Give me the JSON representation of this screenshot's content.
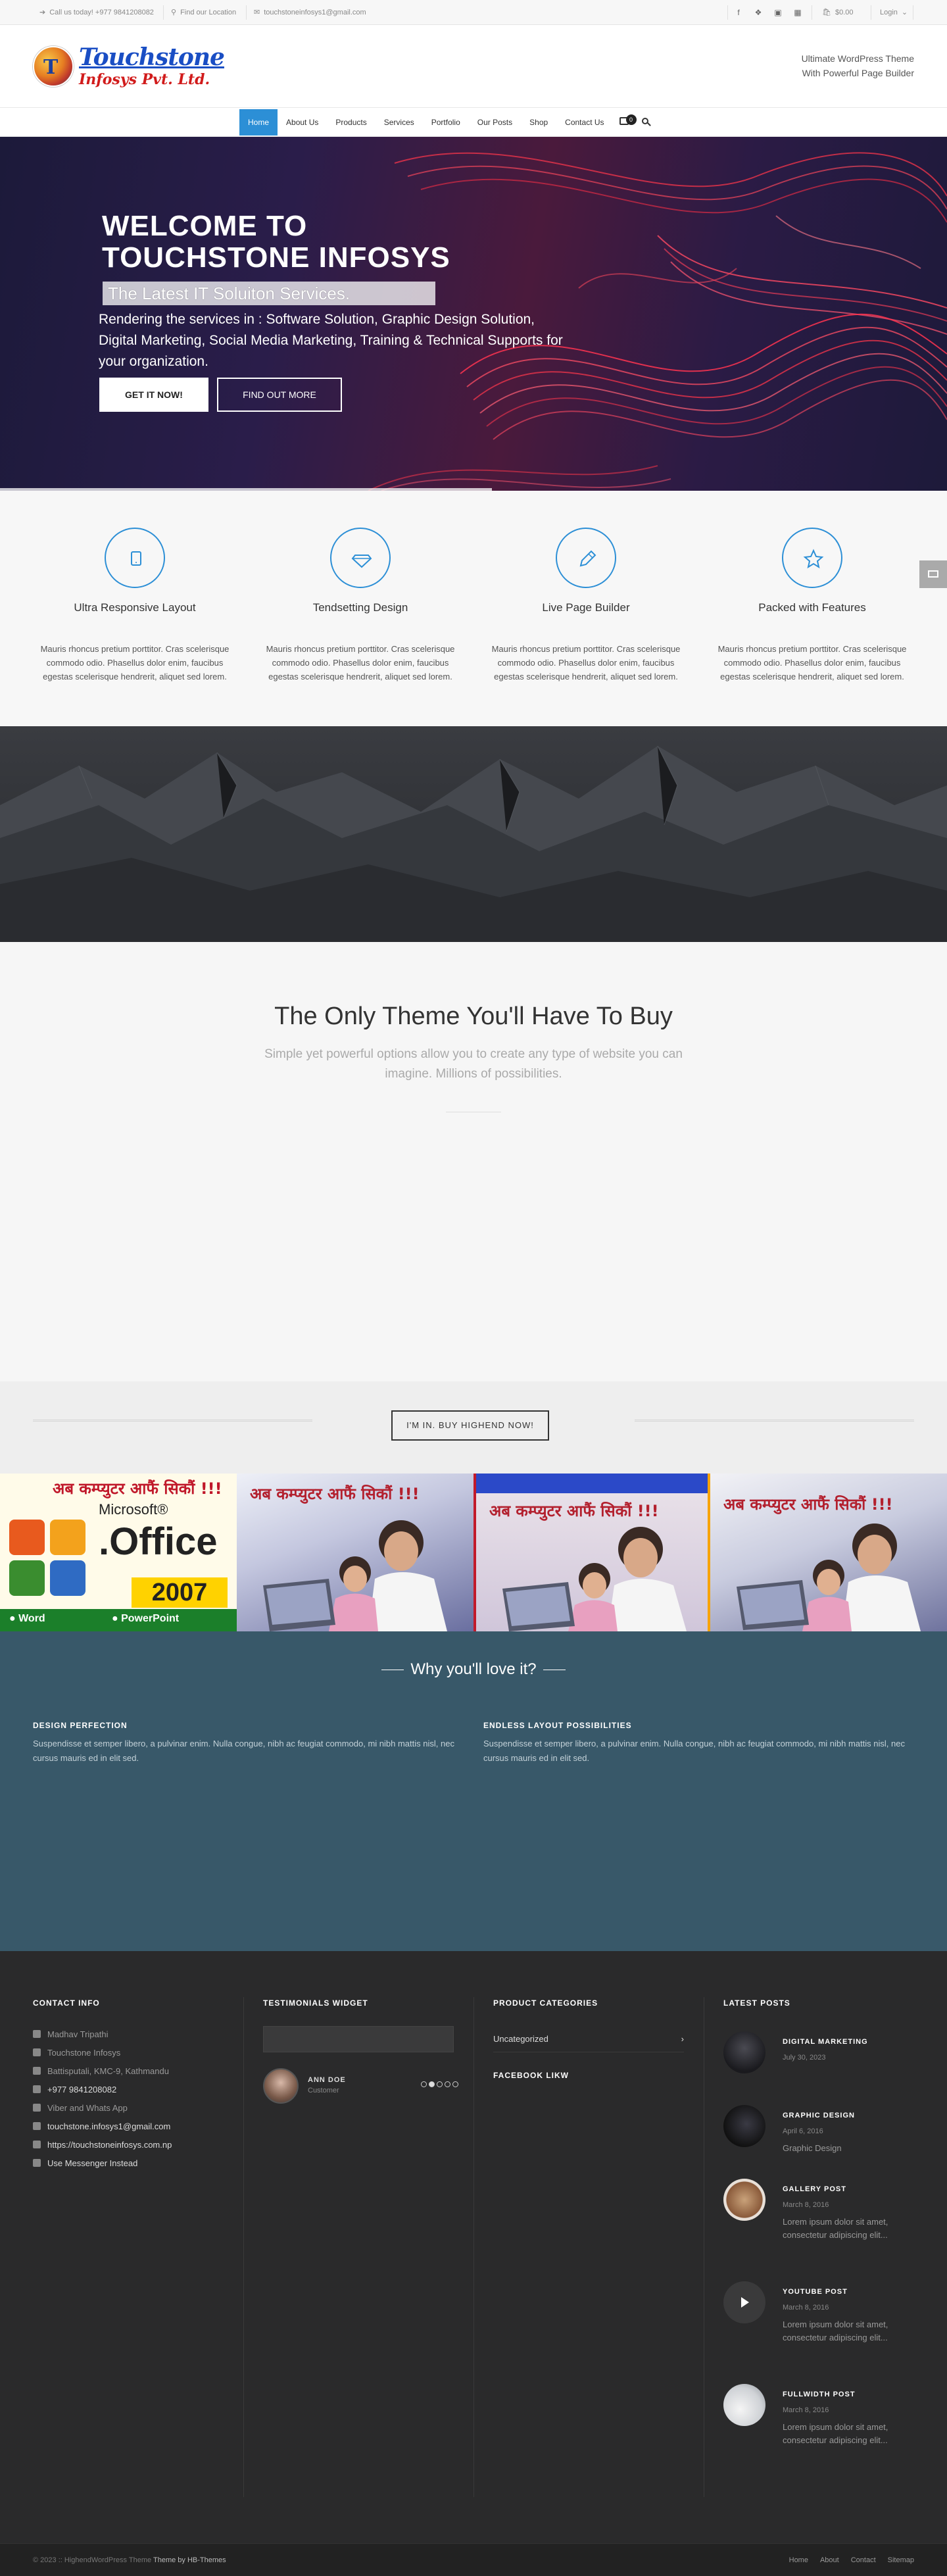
{
  "topbar": {
    "phone": "Call us today! +977 9841208082",
    "location": "Find our Location",
    "email": "touchstoneinfosys1@gmail.com",
    "cart_amount": "$0.00",
    "login": "Login"
  },
  "header": {
    "logo_line1": "Touchstone",
    "logo_line2": "Infosys Pvt. Ltd.",
    "logo_letter": "T",
    "tagline_line1": "Ultimate WordPress Theme",
    "tagline_line2": "With Powerful Page Builder"
  },
  "nav": {
    "items": [
      "Home",
      "About Us",
      "Products",
      "Services",
      "Portfolio",
      "Our Posts",
      "Shop",
      "Contact Us"
    ],
    "cart_count": "0"
  },
  "hero": {
    "title_line1": "WELCOME TO",
    "title_line2": "TOUCHSTONE INFOSYS",
    "subtitle": "The Latest IT Soluiton Services.",
    "description": "Rendering the services in : Software Solution, Graphic Design Solution, Digital Marketing, Social Media Marketing, Training & Technical Supports for your organization.",
    "button_primary": "GET IT NOW!",
    "button_secondary": "FIND OUT MORE"
  },
  "features": [
    {
      "title": "Ultra Responsive Layout",
      "icon": "tablet-icon",
      "desc": "Mauris rhoncus pretium porttitor. Cras scelerisque commodo odio. Phasellus dolor enim, faucibus egestas scelerisque hendrerit, aliquet sed lorem."
    },
    {
      "title": "Tendsetting Design",
      "icon": "diamond-icon",
      "desc": "Mauris rhoncus pretium porttitor. Cras scelerisque commodo odio. Phasellus dolor enim, faucibus egestas scelerisque hendrerit, aliquet sed lorem."
    },
    {
      "title": "Live Page Builder",
      "icon": "pencil-icon",
      "desc": "Mauris rhoncus pretium porttitor. Cras scelerisque commodo odio. Phasellus dolor enim, faucibus egestas scelerisque hendrerit, aliquet sed lorem."
    },
    {
      "title": "Packed with Features",
      "icon": "star-icon",
      "desc": "Mauris rhoncus pretium porttitor. Cras scelerisque commodo odio. Phasellus dolor enim, faucibus egestas scelerisque hendrerit, aliquet sed lorem."
    }
  ],
  "only_theme": {
    "title": "The Only Theme You'll Have To Buy",
    "subtitle": "Simple yet powerful options allow you to create any type of website you can imagine. Millions of possibilities."
  },
  "cta": {
    "button": "I'M IN. BUY HIGHEND NOW!"
  },
  "gallery": {
    "office_ms": "Microsoft®",
    "office_word": ".Office",
    "office_year": "2007",
    "office_bar_left": "● Word",
    "office_bar_right": "● PowerPoint",
    "banner_text": "अब कम्प्युटर आफैं सिकौं !!!"
  },
  "why": {
    "title": "Why you'll love it?",
    "col1_title": "DESIGN PERFECTION",
    "col1_text": "Suspendisse et semper libero, a pulvinar enim. Nulla congue, nibh ac feugiat commodo, mi nibh mattis nisl, nec cursus mauris ed in elit sed.",
    "col2_title": "ENDLESS LAYOUT POSSIBILITIES",
    "col2_text": "Suspendisse et semper libero, a pulvinar enim. Nulla congue, nibh ac feugiat commodo, mi nibh mattis nisl, nec cursus mauris ed in elit sed."
  },
  "footer": {
    "contact_title": "CONTACT INFO",
    "contact_rows": [
      "Madhav Tripathi",
      "Touchstone Infosys",
      "Battisputali, KMC-9, Kathmandu",
      "+977 9841208082",
      "Viber and Whats App",
      "touchstone.infosys1@gmail.com",
      "https://touchstoneinfosys.com.np",
      "Use Messenger Instead"
    ],
    "testimonials_title": "TESTIMONIALS WIDGET",
    "testimonial_name": "ANN DOE",
    "testimonial_role": "Customer",
    "categories_title": "PRODUCT CATEGORIES",
    "category": "Uncategorized",
    "facebook_title": "FACEBOOK LIKW",
    "latest_title": "LATEST POSTS",
    "posts": [
      {
        "title": "DIGITAL MARKETING",
        "date": "July 30, 2023",
        "excerpt": ""
      },
      {
        "title": "GRAPHIC DESIGN",
        "date": "April 6, 2016",
        "excerpt": "Graphic Design"
      },
      {
        "title": "GALLERY POST",
        "date": "March 8, 2016",
        "excerpt": "Lorem ipsum dolor sit amet, consectetur adipiscing elit..."
      },
      {
        "title": "YOUTUBE POST",
        "date": "March 8, 2016",
        "excerpt": "Lorem ipsum dolor sit amet, consectetur adipiscing elit..."
      },
      {
        "title": "FULLWIDTH POST",
        "date": "March 8, 2016",
        "excerpt": "Lorem ipsum dolor sit amet, consectetur adipiscing elit..."
      }
    ]
  },
  "copyright": {
    "text": "© 2023 :: HighendWordPress Theme",
    "by": "Theme by HB-Themes",
    "links": [
      "Home",
      "About",
      "Contact",
      "Sitemap"
    ]
  },
  "colors": {
    "accent": "#2c8fd6",
    "why_bg": "#385869",
    "footer_bg": "#2a2a2b"
  }
}
